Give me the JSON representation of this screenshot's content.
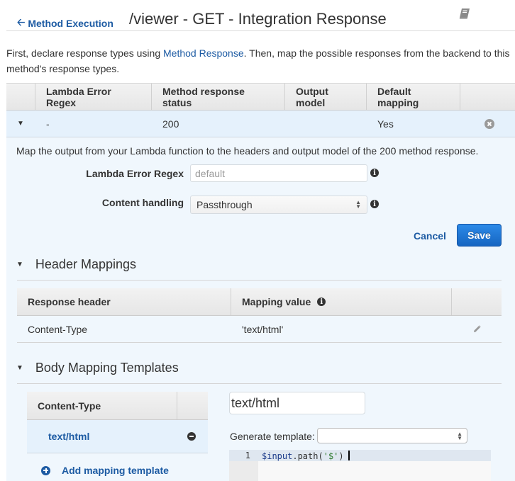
{
  "header": {
    "back_label": "Method Execution",
    "title": "/viewer - GET - Integration Response",
    "help_icon": "book-icon"
  },
  "intro": {
    "before": "First, declare response types using ",
    "link": "Method Response",
    "after": ". Then, map the possible responses from the backend to this method's response types."
  },
  "response_table": {
    "columns": [
      "",
      "Lambda Error Regex",
      "Method response status",
      "Output model",
      "Default mapping",
      ""
    ],
    "rows": [
      {
        "expanded": true,
        "lambda_error_regex": "-",
        "status": "200",
        "output_model": "",
        "default_mapping": "Yes"
      }
    ]
  },
  "detail": {
    "description": "Map the output from your Lambda function to the headers and output model of the 200 method response.",
    "lambda_regex_label": "Lambda Error Regex",
    "lambda_regex_value": "",
    "lambda_regex_placeholder": "default",
    "content_handling_label": "Content handling",
    "content_handling_value": "Passthrough",
    "cancel_label": "Cancel",
    "save_label": "Save"
  },
  "header_mappings": {
    "title": "Header Mappings",
    "columns": [
      "Response header",
      "Mapping value",
      ""
    ],
    "rows": [
      {
        "header": "Content-Type",
        "value": "'text/html'"
      }
    ]
  },
  "body_mapping": {
    "title": "Body Mapping Templates",
    "column": "Content-Type",
    "items": [
      {
        "content_type": "text/html",
        "selected": true
      }
    ],
    "add_label": "Add mapping template",
    "content_type_input": "text/html",
    "generate_label": "Generate template:",
    "generate_value": "",
    "editor": {
      "line_number": "1",
      "code_var": "$input",
      "code_mid": ".path(",
      "code_str": "'$'",
      "code_end": ")"
    }
  },
  "colors": {
    "link": "#1d5ba3",
    "primary_button": "#1665c1",
    "row_selected": "#e5f1fc",
    "panel_background": "#f0f7fd"
  }
}
